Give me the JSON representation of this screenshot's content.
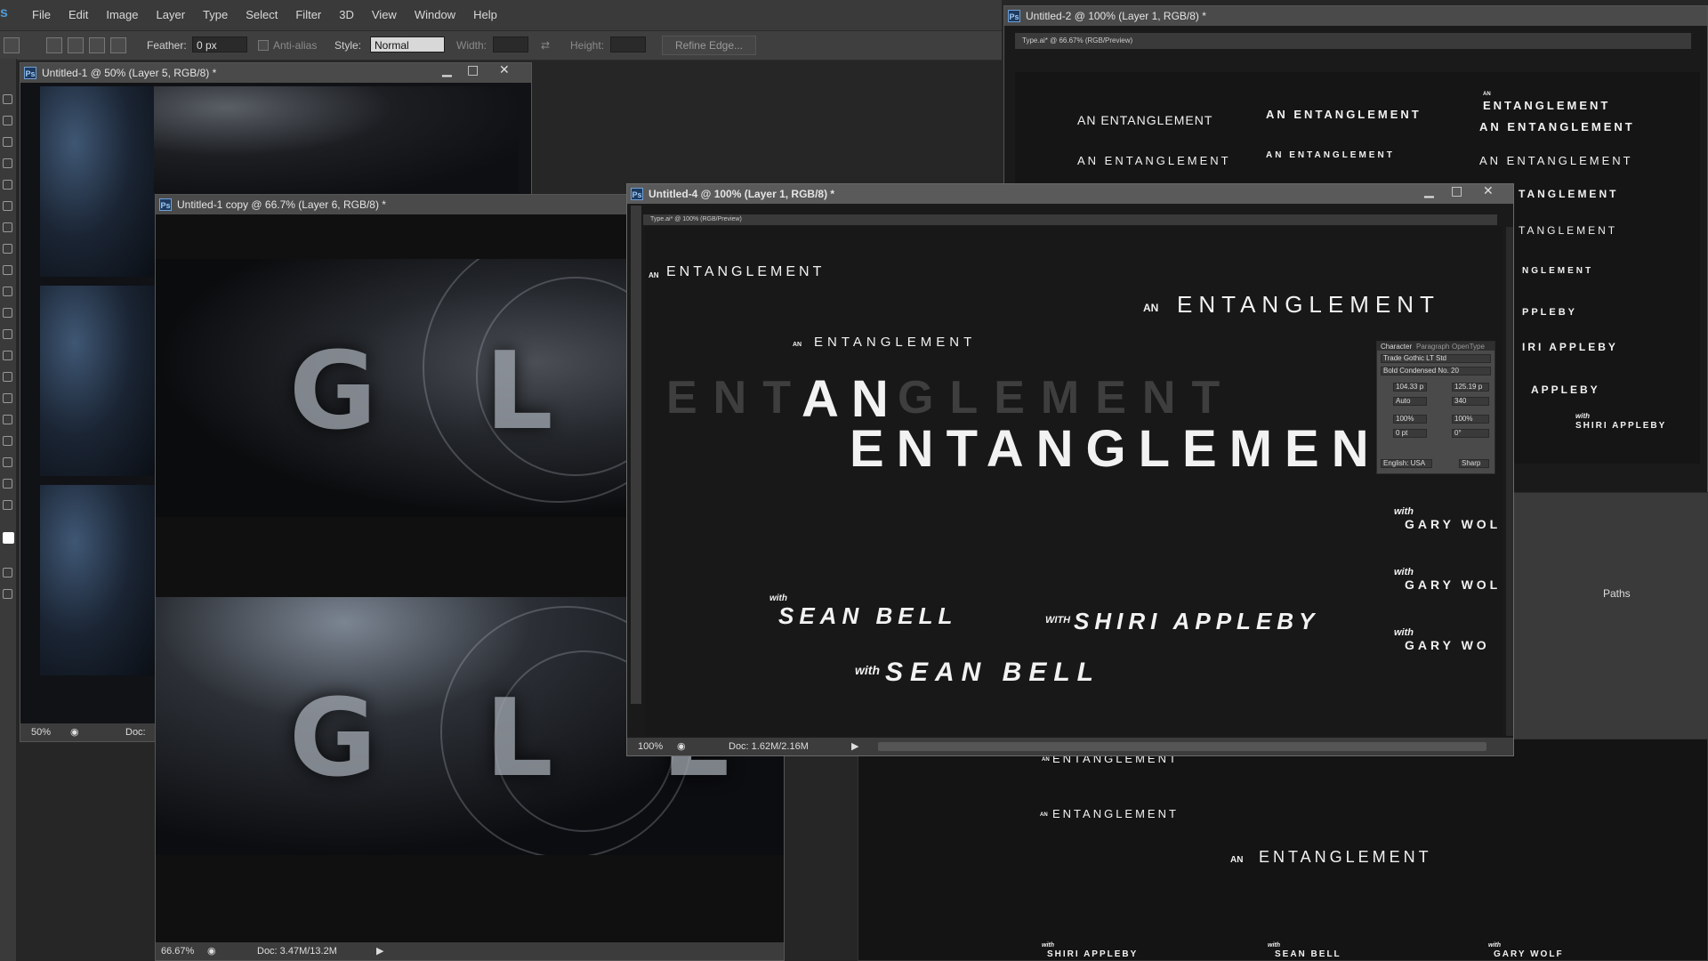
{
  "menu": {
    "logo": "s",
    "items": [
      "File",
      "Edit",
      "Image",
      "Layer",
      "Type",
      "Select",
      "Filter",
      "3D",
      "View",
      "Window",
      "Help"
    ]
  },
  "options": {
    "feather_label": "Feather:",
    "feather_value": "0 px",
    "antialias_label": "Anti-alias",
    "style_label": "Style:",
    "style_value": "Normal",
    "width_label": "Width:",
    "height_label": "Height:",
    "refine_label": "Refine Edge..."
  },
  "windows": {
    "w1": {
      "title": "Untitled-1 @ 50% (Layer 5, RGB/8) *",
      "zoom": "50%",
      "doc": "Doc:"
    },
    "w1copy": {
      "title": "Untitled-1 copy @ 66.7% (Layer 6, RGB/8) *",
      "zoom": "66.67%",
      "doc": "Doc: 3.47M/13.2M",
      "art_letters": "G L E"
    },
    "w2": {
      "title": "Untitled-2 @ 100% (Layer 1, RGB/8) *",
      "tab": "Type.ai* @ 66.67% (RGB/Preview)",
      "texts": [
        "AN ENTANGLEMENT",
        "AN ENTANGLEMENT",
        "AN ENTANGLEMENT",
        "AN ENTANGLEMENT",
        "AN",
        "ENTANGLEMENT",
        "AN ENTANGLEMENT",
        "AN ENTANGLEMENT",
        "TANGLEMENT",
        "TANGLEMENT",
        "NGLEMENT",
        "PPLEBY",
        "IRI APPLEBY",
        "APPLEBY",
        "with",
        "SHIRI APPLEBY"
      ],
      "paths_label": "Paths"
    },
    "w4": {
      "title": "Untitled-4 @ 100% (Layer 1, RGB/8) *",
      "tab": "Type.ai* @ 100% (RGB/Preview)",
      "zoom": "100%",
      "doc": "Doc: 1.62M/2.16M",
      "line1_an": "AN",
      "line1": "ENTANGLEMENT",
      "line2_an": "AN",
      "line2": "ENTANGLEMENT",
      "line3_an": "AN",
      "line3": "ENTANGLEMENT",
      "ghost_left": "ENT",
      "ghost_right": "GLEMENT",
      "big_an": "AN",
      "big_entanglement": "ENTANGLEMENT",
      "with1": "with",
      "sean1": "SEAN BELL",
      "with2": "WITH",
      "shiri": "SHIRI APPLEBY",
      "with3": "with",
      "sean2": "SEAN BELL",
      "with_gary": "with",
      "gary": "GARY WOL",
      "gary_short": "GARY WO",
      "character_panel": {
        "tabs": [
          "Character",
          "Paragraph",
          "OpenType"
        ],
        "font": "Trade Gothic LT Std",
        "style": "Bold Condensed No. 20",
        "size": "104.33 p",
        "leading": "125.19 p",
        "tracking": "340",
        "kerning": "Auto",
        "hscale": "100%",
        "vscale": "100%",
        "baseline": "0 pt",
        "rotation": "0°",
        "lang": "English: USA",
        "aa": "Sharp"
      }
    },
    "w5": {
      "texts": [
        "AN",
        "ENTANGLEMENT",
        "AN",
        "ENTANGLEMENT",
        "AN",
        "ENTANGLEMENT",
        "with",
        "SHIRI APPLEBY",
        "with",
        "SEAN BELL",
        "with",
        "GARY WOLF"
      ]
    }
  }
}
